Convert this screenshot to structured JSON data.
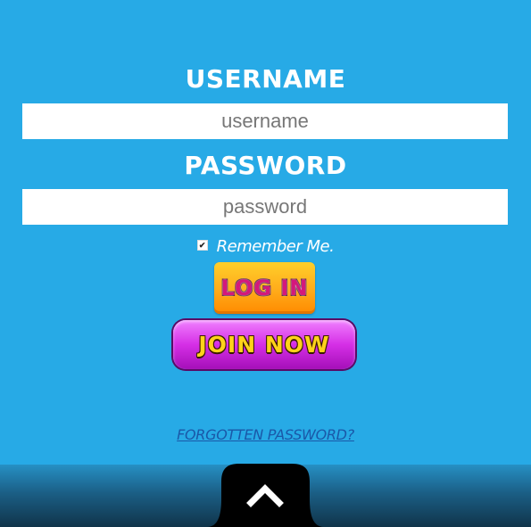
{
  "login_form": {
    "username_label": "USERNAME",
    "username_placeholder": "username",
    "password_label": "PASSWORD",
    "password_placeholder": "password",
    "remember_me": {
      "label": "Remember Me.",
      "checked": true
    },
    "login_button": "LOG IN",
    "join_button": "JOIN NOW",
    "forgot_password_link": "FORGOTTEN PASSWORD?"
  },
  "footer": {
    "scroll_top_icon": "chevron-up-icon"
  },
  "colors": {
    "background": "#27aae6",
    "login_button": "#ffab1a",
    "join_button": "#d52fe6",
    "link": "#1a58a8"
  }
}
